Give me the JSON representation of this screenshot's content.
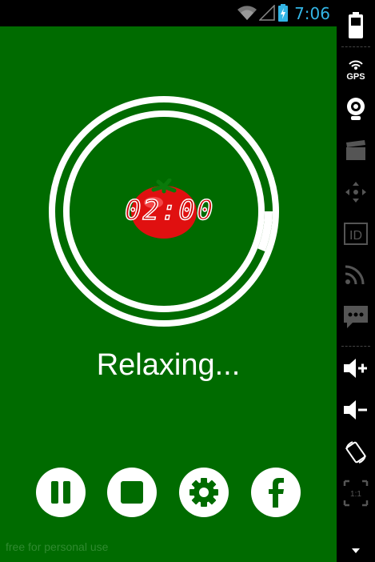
{
  "status_bar": {
    "time": "7:06"
  },
  "app": {
    "timer": "02:00",
    "status": "Relaxing...",
    "progress_fraction": 0.06,
    "credit": "free for personal use",
    "controls": [
      {
        "name": "pause-button",
        "icon": "pause-icon"
      },
      {
        "name": "stop-button",
        "icon": "stop-icon"
      },
      {
        "name": "settings-button",
        "icon": "gear-icon"
      },
      {
        "name": "facebook-button",
        "icon": "facebook-icon"
      }
    ]
  },
  "sidebar": {
    "gps_label": "GPS",
    "id_label": "ID",
    "scale_label": "1:1"
  },
  "colors": {
    "background": "#006b00",
    "foreground": "#ffffff",
    "accent": "#33b5e5",
    "tomato": "#e01010"
  }
}
